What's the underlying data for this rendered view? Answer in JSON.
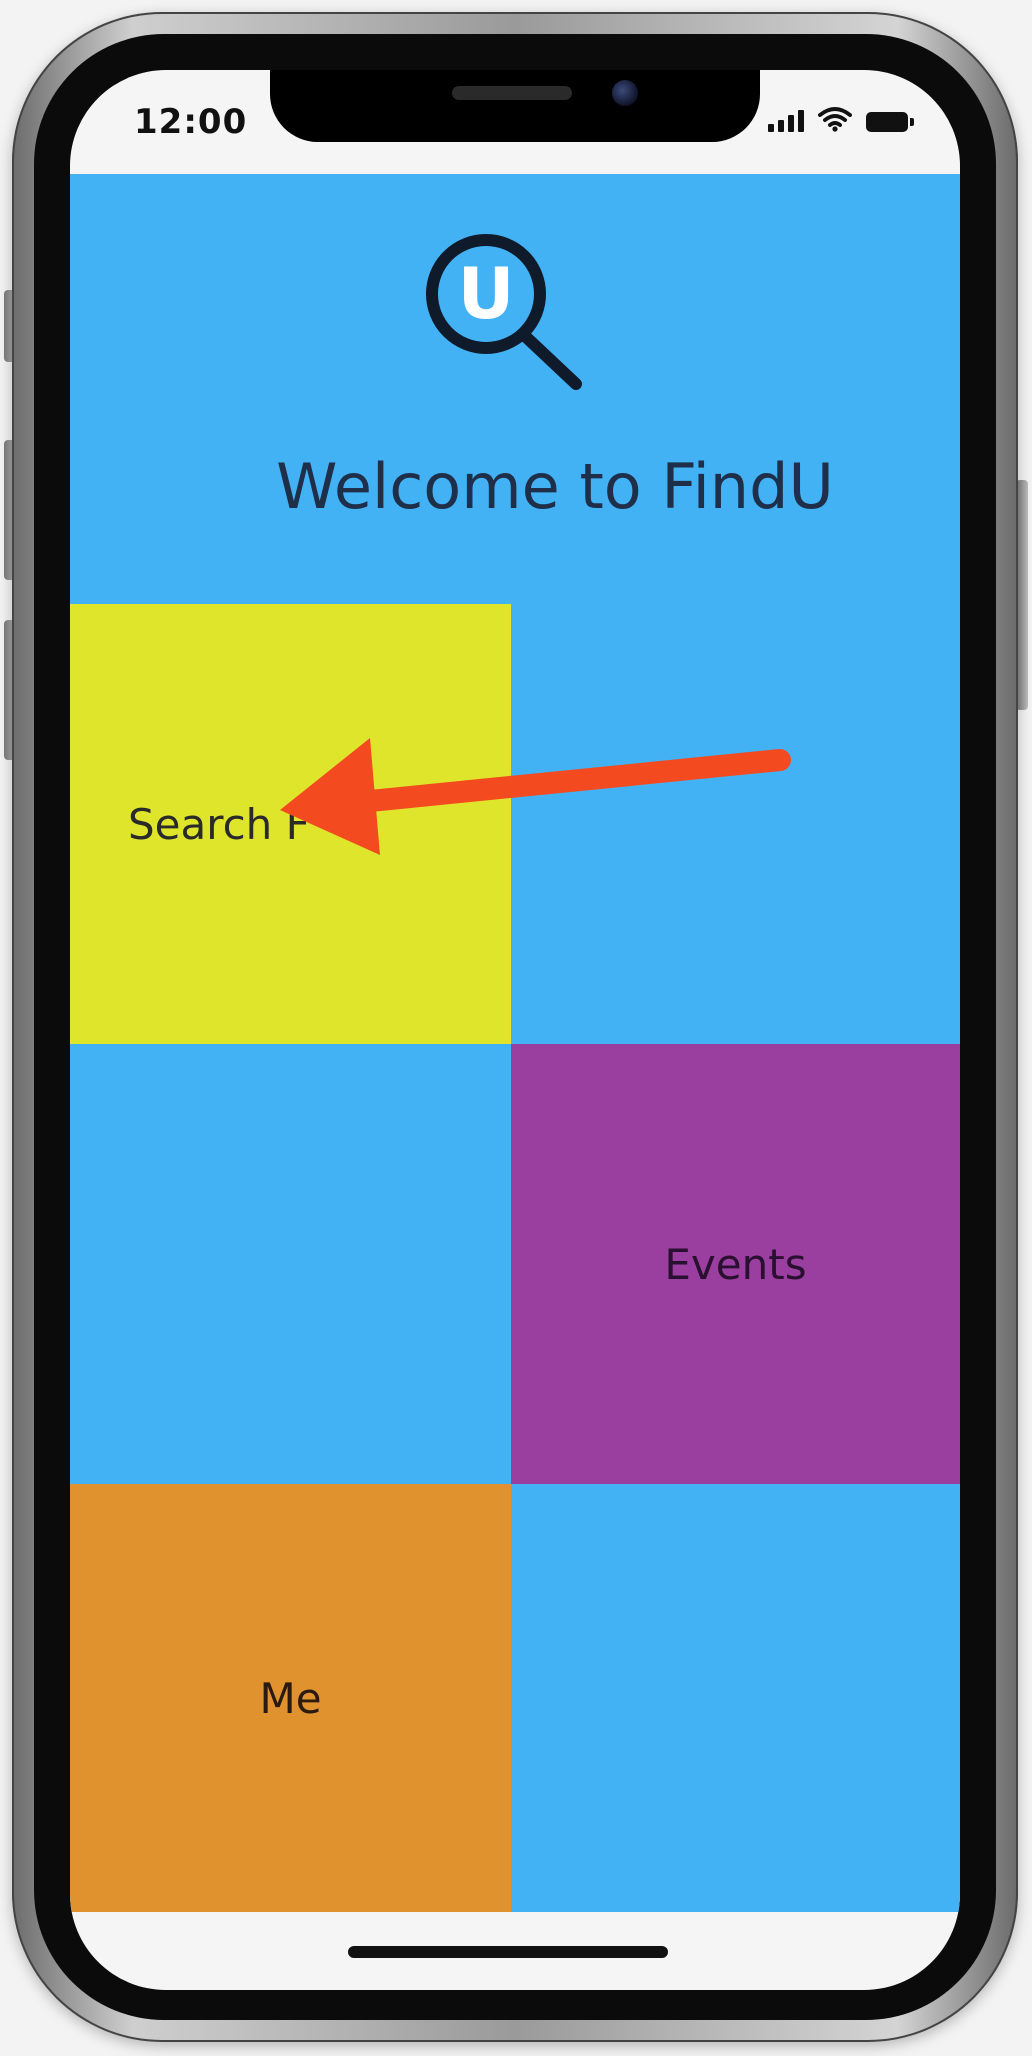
{
  "status_bar": {
    "time": "12:00"
  },
  "app": {
    "logo_letter": "U",
    "welcome_title": "Welcome to FindU",
    "tiles": {
      "search_label": "Search F",
      "events_label": "Events",
      "me_label": "Me"
    },
    "colors": {
      "background": "#43b2f4",
      "search_tile": "#dfe52b",
      "events_tile": "#9a3f9f",
      "me_tile": "#e0922e",
      "annotation_arrow": "#f44a1f"
    }
  },
  "icons": [
    "search-magnifier-logo",
    "signal-icon",
    "wifi-icon",
    "battery-icon",
    "annotation-arrow"
  ]
}
